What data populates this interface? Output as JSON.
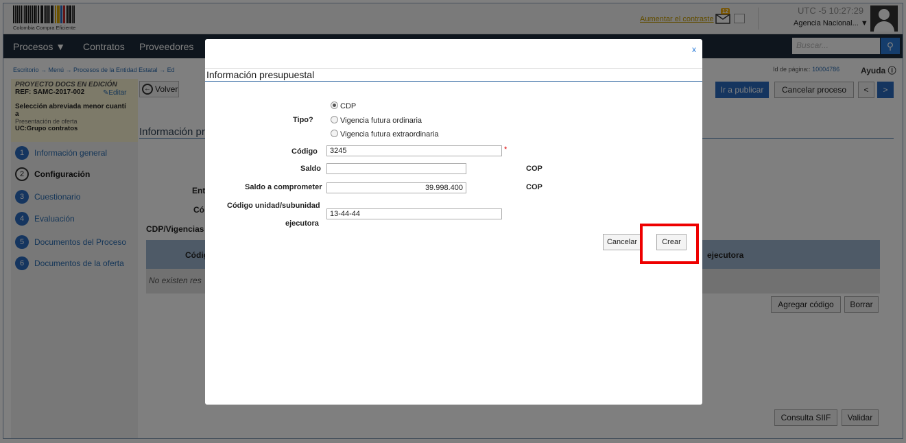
{
  "header": {
    "logo_text": "Colombia Compra Eficiente",
    "contrast_link": "Aumentar el contraste",
    "mail_badge": "12",
    "clock": "UTC -5 10:27:29",
    "agency": "Agencia Nacional..."
  },
  "nav": {
    "items": [
      "Procesos",
      "Contratos",
      "Proveedores"
    ],
    "search_placeholder": "Buscar..."
  },
  "breadcrumb": "Escritorio → Menú → Procesos de la Entidad Estatal → Ed",
  "page_id_label": "Id de página::",
  "page_id": "10004786",
  "help": "Ayuda",
  "project": {
    "status": "PROYECTO DOCS EN EDICIÓN",
    "ref": "REF: SAMC-2017-002",
    "edit": "Editar",
    "type_line1": "Selección abreviada menor cuantí",
    "type_line2": "a",
    "phase": "Presentación de oferta",
    "uc": "UC:Grupo contratos"
  },
  "steps": [
    {
      "num": "1",
      "label": "Información general"
    },
    {
      "num": "2",
      "label": "Configuración"
    },
    {
      "num": "3",
      "label": "Cuestionario"
    },
    {
      "num": "4",
      "label": "Evaluación"
    },
    {
      "num": "5",
      "label": "Documentos del Proceso"
    },
    {
      "num": "6",
      "label": "Documentos de la oferta"
    }
  ],
  "main": {
    "back": "Volver",
    "title": "Información pr",
    "label_ent": "Enti",
    "label_cod": "Có",
    "section": "CDP/Vigencias f",
    "grid_col1": "Códig",
    "grid_col_last": "ejecutora",
    "no_results": "No existen res",
    "publish": "Ir a publicar",
    "cancel_process": "Cancelar proceso",
    "prev": "<",
    "next": ">",
    "add_code": "Agregar código",
    "delete": "Borrar",
    "siif": "Consulta SIIF",
    "validate": "Validar"
  },
  "modal": {
    "close": "x",
    "title": "Información presupuestal",
    "tipo_label": "Tipo?",
    "tipo_options": [
      "CDP",
      "Vigencia futura ordinaria",
      "Vigencia futura extraordinaria"
    ],
    "tipo_selected": "CDP",
    "codigo_label": "Código",
    "codigo_value": "3245",
    "required_mark": "*",
    "saldo_label": "Saldo",
    "saldo_value": "",
    "saldo_currency": "COP",
    "saldo_comp_label": "Saldo a comprometer",
    "saldo_comp_value": "39.998.400",
    "saldo_comp_currency": "COP",
    "unidad_label_1": "Código unidad/subunidad",
    "unidad_label_2": "ejecutora",
    "unidad_value": "13-44-44",
    "cancel": "Cancelar",
    "create": "Crear"
  }
}
